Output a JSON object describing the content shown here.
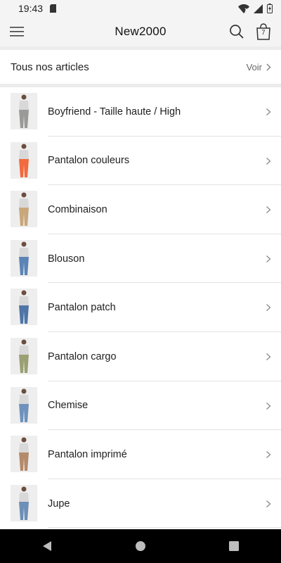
{
  "status_bar": {
    "time": "19:43"
  },
  "app_bar": {
    "title": "New2000",
    "cart_count": "7"
  },
  "all_articles": {
    "label": "Tous nos articles",
    "see_all": "Voir"
  },
  "categories": [
    {
      "label": "Boyfriend - Taille haute / High",
      "color": "#9a9a98"
    },
    {
      "label": "Pantalon couleurs",
      "color": "#f26a3d"
    },
    {
      "label": "Combinaison",
      "color": "#c8a77a"
    },
    {
      "label": "Blouson",
      "color": "#5b84b5"
    },
    {
      "label": "Pantalon patch",
      "color": "#4f74a6"
    },
    {
      "label": "Pantalon cargo",
      "color": "#9aa074"
    },
    {
      "label": "Chemise",
      "color": "#6f92bd"
    },
    {
      "label": "Pantalon imprimé",
      "color": "#b58a6a"
    },
    {
      "label": "Jupe",
      "color": "#6e8fb6"
    }
  ]
}
